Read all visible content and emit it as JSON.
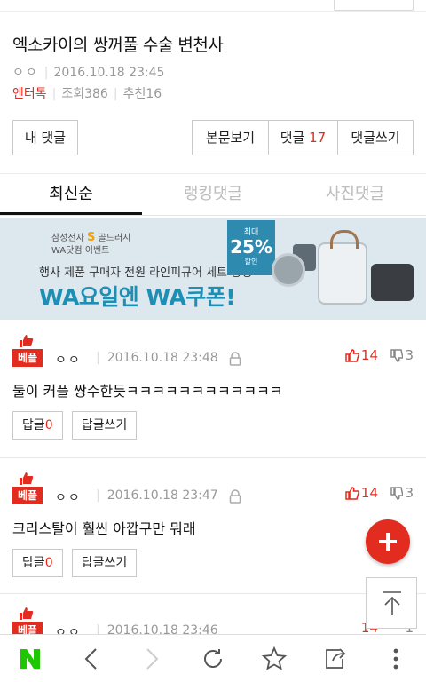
{
  "article": {
    "title": "엑소카이의 쌍꺼풀 수술 변천사",
    "author": "ㅇㅇ",
    "date": "2016.10.18 23:45",
    "category": "엔터톡",
    "views": "조회386",
    "recommends": "추천16"
  },
  "buttons": {
    "my_comments": "내 댓글",
    "view_body": "본문보기",
    "comments_label": "댓글",
    "comments_count": "17",
    "write_comment": "댓글쓰기"
  },
  "tabs": [
    "최신순",
    "랭킹댓글",
    "사진댓글"
  ],
  "ad": {
    "brand_small": "삼성전자",
    "brand_s": "S",
    "brand_name": "골드러시",
    "event": "WA닷컴 이벤트",
    "line1": "행사 제품 구매자 전원 라인피규어 세트 증정",
    "line2": "WA요일엔 WA쿠폰!",
    "badge_top": "최대",
    "badge_pct": "25%",
    "badge_bottom": "할인"
  },
  "comments": [
    {
      "badge": "베플",
      "author": "ㅇㅇ",
      "date": "2016.10.18 23:48",
      "likes": "14",
      "dislikes": "3",
      "text": "둘이 커플 쌍수한듯ㅋㅋㅋㅋㅋㅋㅋㅋㅋㅋㅋㅋ",
      "reply_label": "답글",
      "reply_count": "0",
      "write_reply": "답글쓰기"
    },
    {
      "badge": "베플",
      "author": "ㅇㅇ",
      "date": "2016.10.18 23:47",
      "likes": "14",
      "dislikes": "3",
      "text": "크리스탈이 훨씬 아깝구만 뭐래",
      "reply_label": "답글",
      "reply_count": "0",
      "write_reply": "답글쓰기"
    },
    {
      "badge": "베플",
      "author": "ㅇㅇ",
      "date": "2016.10.18 23:46",
      "likes": "14",
      "dislikes": "1"
    }
  ],
  "colors": {
    "accent": "#e22c1f",
    "naver_green": "#1ec800",
    "ad_blue": "#1d8fb5"
  },
  "icons": [
    "naver-icon",
    "back-icon",
    "forward-icon",
    "refresh-icon",
    "bookmark-star-icon",
    "share-icon",
    "more-icon"
  ]
}
